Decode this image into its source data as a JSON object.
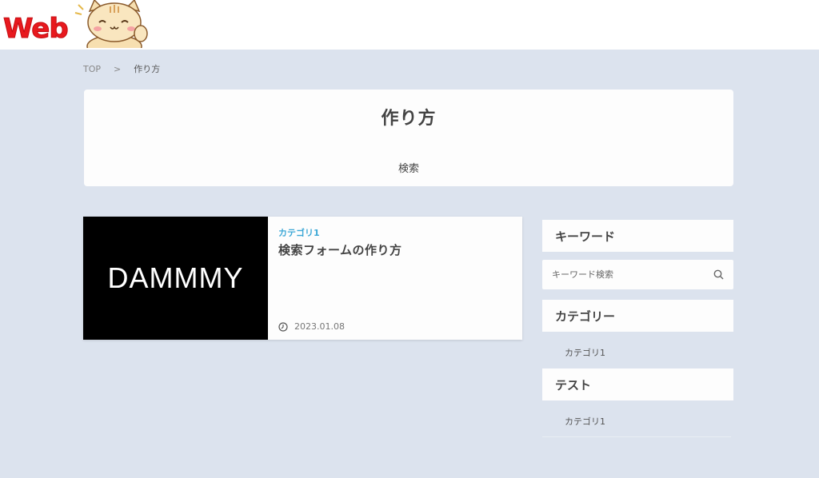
{
  "header": {
    "logo_text": "Web"
  },
  "breadcrumb": {
    "home": "TOP",
    "separator": ">",
    "current": "作り方"
  },
  "page_header": {
    "title": "作り方",
    "subtitle": "検索"
  },
  "posts": [
    {
      "thumbnail_text": "DAMMMY",
      "category": "カテゴリ1",
      "title": "検索フォームの作り方",
      "date": "2023.01.08"
    }
  ],
  "sidebar": {
    "keyword_heading": "キーワード",
    "search_placeholder": "キーワード検索",
    "category_heading": "カテゴリー",
    "category_items": [
      "カテゴリ1"
    ],
    "test_heading": "テスト",
    "test_items": [
      "カテゴリ1"
    ]
  },
  "colors": {
    "background": "#dce3ee",
    "accent_category": "#3da8d6",
    "logo_red": "#e8191e"
  }
}
